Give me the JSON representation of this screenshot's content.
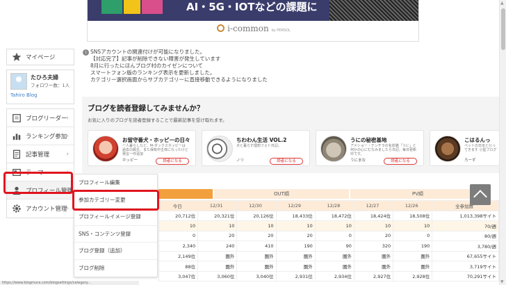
{
  "banner": {
    "headline": "AI・5G・IOTなどの課題に",
    "brand": "i-common",
    "brand_by": "by PERSOL"
  },
  "sidebar": {
    "mypage": "マイページ",
    "profile": {
      "name": "たひろ夫婦",
      "followers": "フォロワー数：1人",
      "blog": "Tahiro Blog"
    },
    "items": [
      {
        "label": "ブログリーダー",
        "icon": "book-icon"
      },
      {
        "label": "ランキング参加",
        "icon": "ranking-icon"
      },
      {
        "label": "記事管理",
        "icon": "document-icon"
      },
      {
        "label": "テーマ",
        "icon": "theme-icon"
      },
      {
        "label": "プロフィール管理",
        "icon": "user-icon"
      },
      {
        "label": "アカウント管理",
        "icon": "gear-icon"
      }
    ]
  },
  "dropdown": {
    "items": [
      "プロフィール編集",
      "参加カテゴリー変更",
      "プロフィールイメージ登録",
      "SNS・コンテンツ登録",
      "ブログ登録（追加）",
      "ブログ削除"
    ]
  },
  "notes": [
    "SNSアカウントの関連付けが可能になりました。",
    "【対応完了】記事が削除できない障害が発生しています",
    "8月に行ったにほんブログ村のカイゼンについて",
    "スマートフォン版のランキング表示を更新しました。",
    "カテゴリー選択画面からサブカテゴリーに直接移動できるようになりました"
  ],
  "subscribe": {
    "title": "ブログを読者登録してみませんか？",
    "desc": "お気に入りのブログを読者登録することで最新記事を受け取れます。",
    "button": "読者になる",
    "cards": [
      {
        "title": "お留守番犬・ホッピーの日々",
        "desc": "一人暮らしなど、M-ダックスホッピーは 過去の飼主、また保有中主体になったけど 発言一件追加",
        "author": "ホッピー"
      },
      {
        "title": "ちわわん生活 VOL.2",
        "desc": "犬と暮らす理想フォト日記。",
        "author": "ノリ"
      },
      {
        "title": "うにの秘密基地",
        "desc": "アメショー・テンチラの名前猫「うに」と 何かの心にむなみましたら日記。毎日更新中です。",
        "author": "うにまな"
      },
      {
        "title": "こはるんっ",
        "desc": "ペットの日本と行ってきます 小型ブログ中",
        "author": "ろーず"
      }
    ]
  },
  "stats": {
    "tabs": [
      "",
      "OUT順",
      "PV順"
    ],
    "header": [
      "今日",
      "12/31",
      "12/30",
      "12/29",
      "12/28",
      "12/27",
      "12/26",
      "全参加数"
    ],
    "rows": [
      [
        "20,712位",
        "20,321位",
        "20,126位",
        "18,433位",
        "18,472位",
        "18,424位",
        "18,508位",
        "1,013,398サイト"
      ],
      [
        "10",
        "10",
        "10",
        "10",
        "10",
        "10",
        "10",
        "70/週"
      ],
      [
        "0",
        "20",
        "20",
        "20",
        "0",
        "20",
        "0",
        "80/週"
      ],
      [
        "2,340",
        "240",
        "410",
        "190",
        "90",
        "320",
        "190",
        "3,780/週"
      ],
      [
        "2,149位",
        "圏外",
        "圏外",
        "圏外",
        "圏外",
        "圏外",
        "圏外",
        "67,655サイト"
      ],
      [
        "88位",
        "圏外",
        "圏外",
        "圏外",
        "圏外",
        "圏外",
        "圏外",
        "3,719サイト"
      ],
      [
        "3,047位",
        "3,060位",
        "3,040位",
        "2,931位",
        "2,934位",
        "2,927位",
        "2,928位",
        "70,291サイト"
      ]
    ]
  },
  "status_url": "https://www.blogmura.com/blogsettings/category..."
}
